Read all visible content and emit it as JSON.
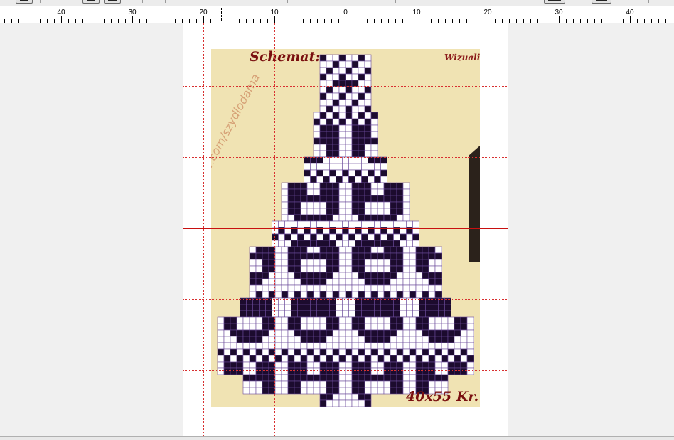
{
  "ruler": {
    "labels": [
      "40",
      "30",
      "20",
      "10",
      "0",
      "10",
      "20",
      "30",
      "40"
    ]
  },
  "pattern": {
    "title": "Schemat:",
    "subtitle": "Wizualiz",
    "size_label": "40x55 Kr.",
    "watermark": "buycoffee.com/szydlodama",
    "colors": {
      "background": "#f0e3b3",
      "filled_cell": "#1c0b2e",
      "empty_cell": "#ffffff",
      "grid_line": "#6a4a9a",
      "title_text": "#7a1010",
      "guide_line": "#c81010"
    }
  }
}
